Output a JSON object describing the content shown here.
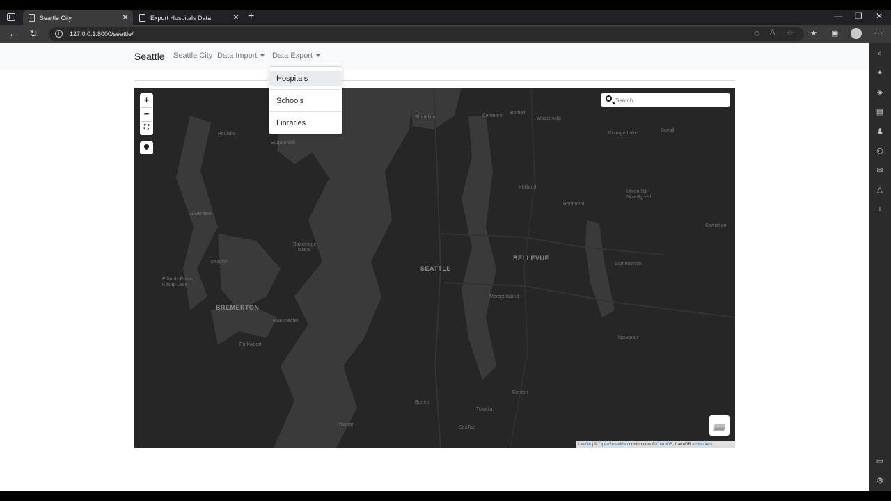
{
  "browser": {
    "tabs": [
      {
        "title": "Seattle City",
        "active": true
      },
      {
        "title": "Export Hospitals Data",
        "active": false
      }
    ],
    "url": "127.0.0.1:8000/seattle/"
  },
  "navbar": {
    "brand": "Seattle",
    "links": [
      "Seattle City",
      "Data Import",
      "Data Export"
    ]
  },
  "dropdown": {
    "items": [
      "Hospitals",
      "Schools",
      "Libraries"
    ],
    "highlighted": "Hospitals"
  },
  "map": {
    "search_placeholder": "Search...",
    "labels": {
      "big": [
        "SEATTLE",
        "BELLEVUE",
        "BREMERTON"
      ],
      "small": [
        "Poulsbo",
        "Suquamish",
        "Kenmore",
        "Bothell",
        "Shoreline",
        "Woodinville",
        "Cottage Lake",
        "Duvall",
        "Kirkland",
        "Silverdale",
        "Union Hill-",
        "Novelty Hill",
        "Redmond",
        "Carnation",
        "Bainbridge",
        "Island",
        "Tracyton",
        "Sammamish",
        "Erlands Point-",
        "Kitsap Lake",
        "Mercer Island",
        "Manchester",
        "Parkwood",
        "Issaquah",
        "Renton",
        "Burien",
        "Tukwila",
        "Vashon",
        "SeaTac"
      ]
    },
    "attribution": {
      "leaflet": "Leaflet",
      "osm": "OpenStreetMap",
      "contributors": "contributors ©",
      "carto": "CartoDB",
      "cartodb_text": ", CartoDB",
      "attributions": "attributions"
    }
  },
  "colors": {
    "map_land": "#262626",
    "map_water": "#3a3a3a",
    "navbar_bg": "#f8f9fa",
    "link": "#2a6fbb"
  },
  "icons": [
    "tab-menu-icon",
    "document-icon",
    "close-icon",
    "plus-icon",
    "back-icon",
    "refresh-icon",
    "info-icon",
    "search-icon",
    "pin-icon",
    "layers-icon",
    "fullscreen-icon"
  ]
}
